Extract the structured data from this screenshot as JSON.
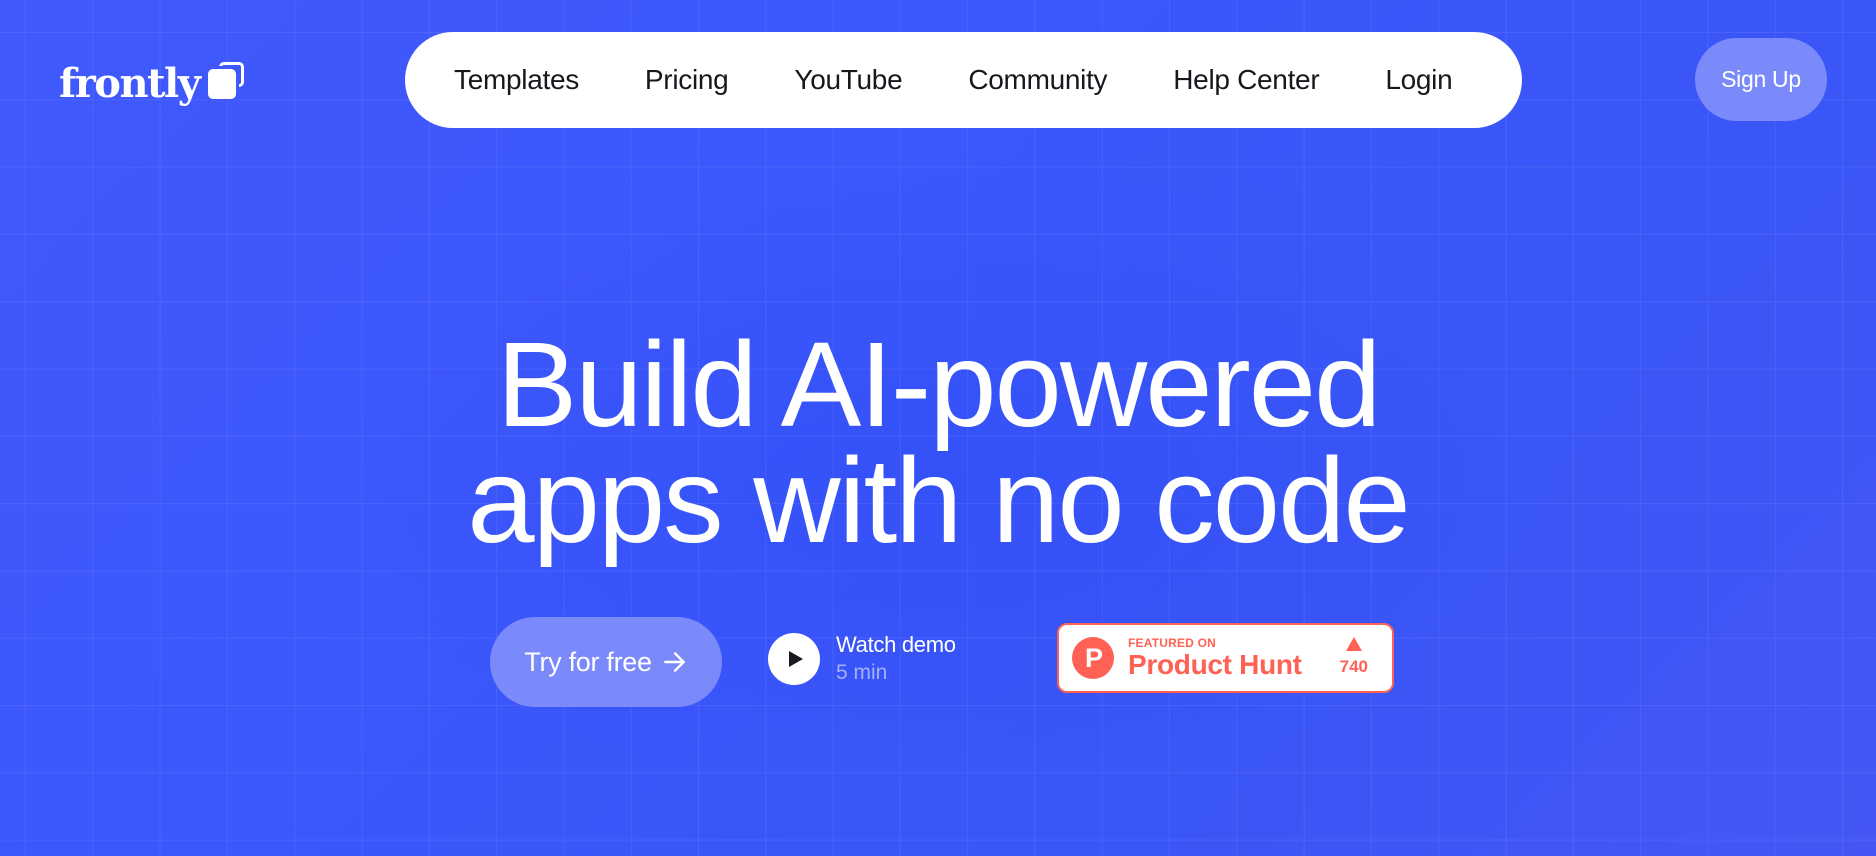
{
  "brand": {
    "name": "frontly",
    "logo_icon": "stacked-squares-icon"
  },
  "nav": {
    "items": [
      {
        "label": "Templates"
      },
      {
        "label": "Pricing"
      },
      {
        "label": "YouTube"
      },
      {
        "label": "Community"
      },
      {
        "label": "Help Center"
      },
      {
        "label": "Login"
      }
    ],
    "signup_label": "Sign Up"
  },
  "hero": {
    "headline_line1": "Build AI-powered",
    "headline_line2": "apps with no code",
    "cta_label": "Try for free",
    "cta_icon": "arrow-right-icon",
    "demo": {
      "title": "Watch demo",
      "duration": "5 min",
      "icon": "play-icon"
    },
    "product_hunt": {
      "featured_label": "FEATURED ON",
      "name": "Product Hunt",
      "logo_letter": "P",
      "upvote_icon": "triangle-up-icon",
      "votes": "740"
    }
  },
  "colors": {
    "background": "#3f58fb",
    "button_fill": "#7b8afa",
    "nav_text": "#17181d",
    "product_hunt": "#ff6154",
    "demo_sub": "#a3b0fb"
  }
}
